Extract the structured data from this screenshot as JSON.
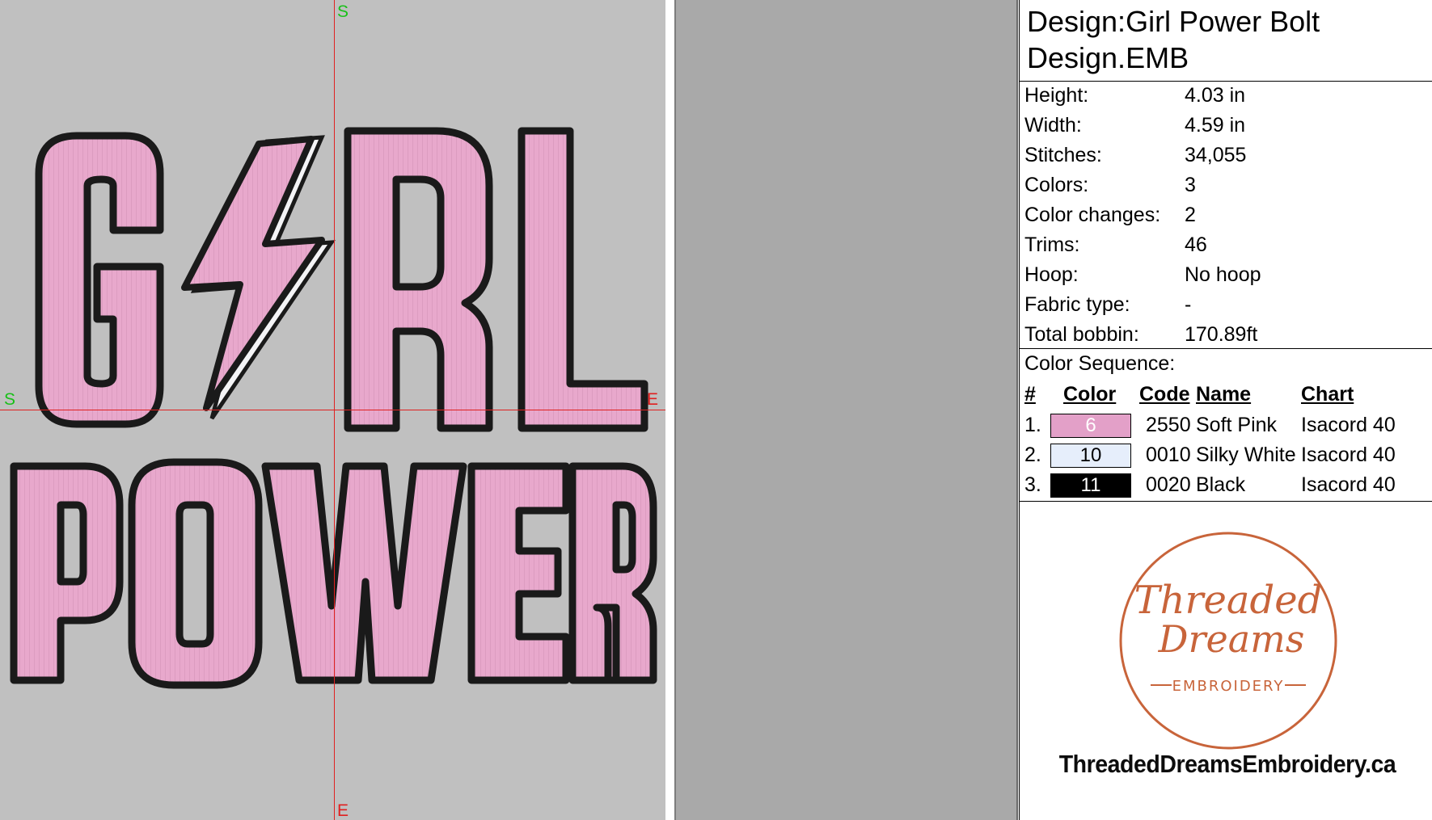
{
  "canvas": {
    "artwork_lines": [
      "G⚡RL",
      "POWER"
    ],
    "axis_labels": {
      "top": "S",
      "bottom": "E",
      "left": "S",
      "right": "E"
    }
  },
  "info": {
    "title": "Design:Girl Power Bolt Design.EMB",
    "stats": [
      {
        "label": "Height:",
        "value": "4.03 in"
      },
      {
        "label": "Width:",
        "value": "4.59 in"
      },
      {
        "label": "Stitches:",
        "value": "34,055"
      },
      {
        "label": "Colors:",
        "value": "3"
      },
      {
        "label": "Color changes:",
        "value": "2"
      },
      {
        "label": "Trims:",
        "value": "46"
      },
      {
        "label": "Hoop:",
        "value": "No hoop"
      },
      {
        "label": "Fabric type:",
        "value": "-"
      },
      {
        "label": "Total bobbin:",
        "value": "170.89ft"
      }
    ],
    "color_sequence_label": "Color Sequence:",
    "columns": {
      "num": "#",
      "color": "Color",
      "code": "Code",
      "name": "Name",
      "chart": "Chart"
    },
    "sequence": [
      {
        "num": "1.",
        "swatch": "6",
        "swatch_color": "#e3a0c8",
        "swatch_text_color": "#ffffff",
        "code": "2550",
        "name": "Soft Pink",
        "chart": "Isacord 40"
      },
      {
        "num": "2.",
        "swatch": "10",
        "swatch_color": "#e6eefb",
        "swatch_text_color": "#000000",
        "code": "0010",
        "name": "Silky White",
        "chart": "Isacord 40"
      },
      {
        "num": "3.",
        "swatch": "11",
        "swatch_color": "#000000",
        "swatch_text_color": "#ffffff",
        "code": "0020",
        "name": "Black",
        "chart": "Isacord 40"
      }
    ],
    "logo": {
      "line1": "Threaded",
      "line2": "Dreams",
      "line3": "EMBROIDERY",
      "color": "#c8643a"
    },
    "website": "ThreadedDreamsEmbroidery.ca"
  },
  "colors": {
    "thread_pink": "#e8a8cc",
    "outline": "#1a1a1a",
    "canvas_bg": "#c0c0c0",
    "axis_red": "#e02020",
    "axis_green": "#18c018"
  }
}
